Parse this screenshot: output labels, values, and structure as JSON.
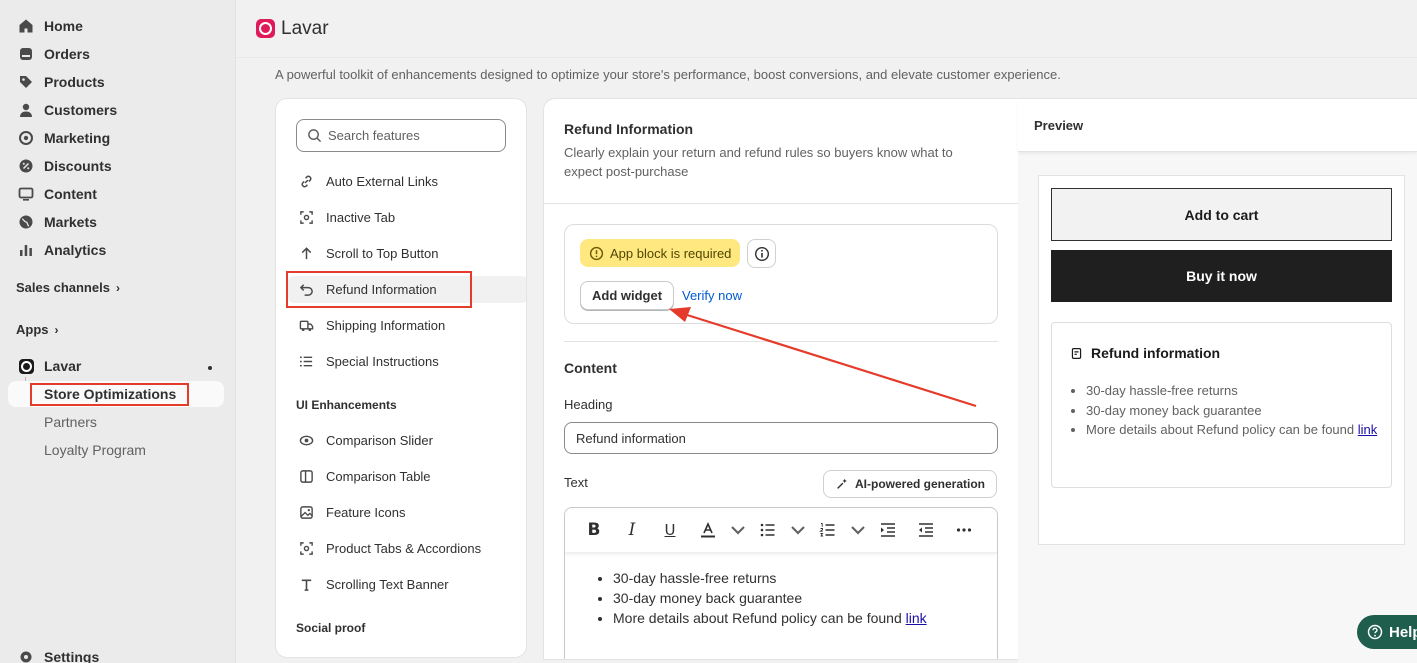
{
  "nav": {
    "items": [
      {
        "label": "Home",
        "icon": "home-icon"
      },
      {
        "label": "Orders",
        "icon": "orders-icon"
      },
      {
        "label": "Products",
        "icon": "tag-icon"
      },
      {
        "label": "Customers",
        "icon": "person-icon"
      },
      {
        "label": "Marketing",
        "icon": "target-icon"
      },
      {
        "label": "Discounts",
        "icon": "discount-icon"
      },
      {
        "label": "Content",
        "icon": "monitor-icon"
      },
      {
        "label": "Markets",
        "icon": "globe-icon"
      },
      {
        "label": "Analytics",
        "icon": "bar-chart-icon"
      }
    ],
    "sales_channels": "Sales channels",
    "apps": "Apps",
    "app_name": "Lavar",
    "sub_items": [
      "Store Optimizations",
      "Partners",
      "Loyalty Program"
    ],
    "settings": "Settings"
  },
  "header": {
    "title": "Lavar"
  },
  "page": {
    "subtitle": "A powerful toolkit of enhancements designed to optimize your store's performance, boost conversions, and elevate customer experience."
  },
  "features": {
    "search_placeholder": "Search features",
    "items": [
      "Auto External Links",
      "Inactive Tab",
      "Scroll to Top Button",
      "Refund Information",
      "Shipping Information",
      "Special Instructions"
    ],
    "group_ui": "UI Enhancements",
    "ui_items": [
      "Comparison Slider",
      "Comparison Table",
      "Feature Icons",
      "Product Tabs & Accordions",
      "Scrolling Text Banner"
    ],
    "group_social": "Social proof"
  },
  "settings": {
    "title": "Refund Information",
    "description": "Clearly explain your return and refund rules so buyers know what to expect post-purchase",
    "warning": "App block is required",
    "add_widget": "Add widget",
    "verify": "Verify now",
    "content_heading": "Content",
    "heading_label": "Heading",
    "heading_value": "Refund information",
    "text_label": "Text",
    "ai_button": "AI-powered generation",
    "editor_lines": [
      "30-day hassle-free returns",
      "30-day money back guarantee",
      "More details about Refund policy can be found "
    ],
    "editor_link": "link"
  },
  "preview": {
    "title": "Preview",
    "add_to_cart": "Add to cart",
    "buy_now": "Buy it now",
    "refund_title": "Refund information",
    "lines": [
      "30-day hassle-free returns",
      "30-day money back guarantee",
      "More details about Refund policy can be found "
    ],
    "link": "link"
  },
  "help": {
    "label": "Help"
  },
  "colors": {
    "accent": "#005bd3",
    "annotation": "#e53b2a",
    "warning_bg": "#ffe880",
    "help_bg": "#1f5d4c"
  }
}
